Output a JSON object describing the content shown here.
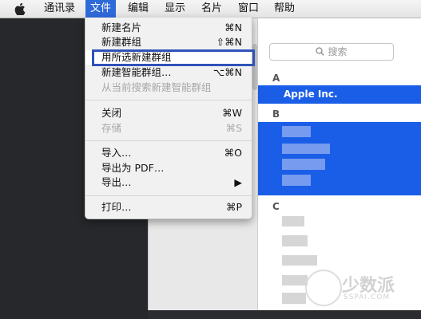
{
  "menubar": {
    "items": [
      "通讯录",
      "文件",
      "编辑",
      "显示",
      "名片",
      "窗口",
      "帮助"
    ],
    "active": "文件"
  },
  "file_menu": {
    "items": [
      {
        "label": "新建名片",
        "shortcut": "⌘N",
        "enabled": true
      },
      {
        "label": "新建群组",
        "shortcut": "⇧⌘N",
        "enabled": true
      },
      {
        "label": "用所选新建群组",
        "shortcut": "",
        "enabled": true,
        "highlighted": true
      },
      {
        "label": "新建智能群组…",
        "shortcut": "⌥⌘N",
        "enabled": true
      },
      {
        "label": "从当前搜索新建智能群组",
        "shortcut": "",
        "enabled": false
      },
      {
        "label": "关闭",
        "shortcut": "⌘W",
        "enabled": true
      },
      {
        "label": "存储",
        "shortcut": "⌘S",
        "enabled": false
      },
      {
        "label": "导入…",
        "shortcut": "⌘O",
        "enabled": true
      },
      {
        "label": "导出为 PDF…",
        "shortcut": "",
        "enabled": true
      },
      {
        "label": "导出…",
        "shortcut": "▶",
        "enabled": true
      },
      {
        "label": "打印…",
        "shortcut": "⌘P",
        "enabled": true
      }
    ]
  },
  "contacts": {
    "search_placeholder": "搜索",
    "sections": [
      {
        "letter": "A",
        "entries": [
          "Apple Inc."
        ]
      },
      {
        "letter": "B",
        "entries": []
      },
      {
        "letter": "C",
        "entries": []
      }
    ]
  },
  "watermark": {
    "text": "少数派",
    "sub": "SSPAI.COM"
  },
  "colors": {
    "accent": "#1a5ee8",
    "menu_active": "#2f6ad9",
    "highlight_border": "#2f53b8"
  }
}
